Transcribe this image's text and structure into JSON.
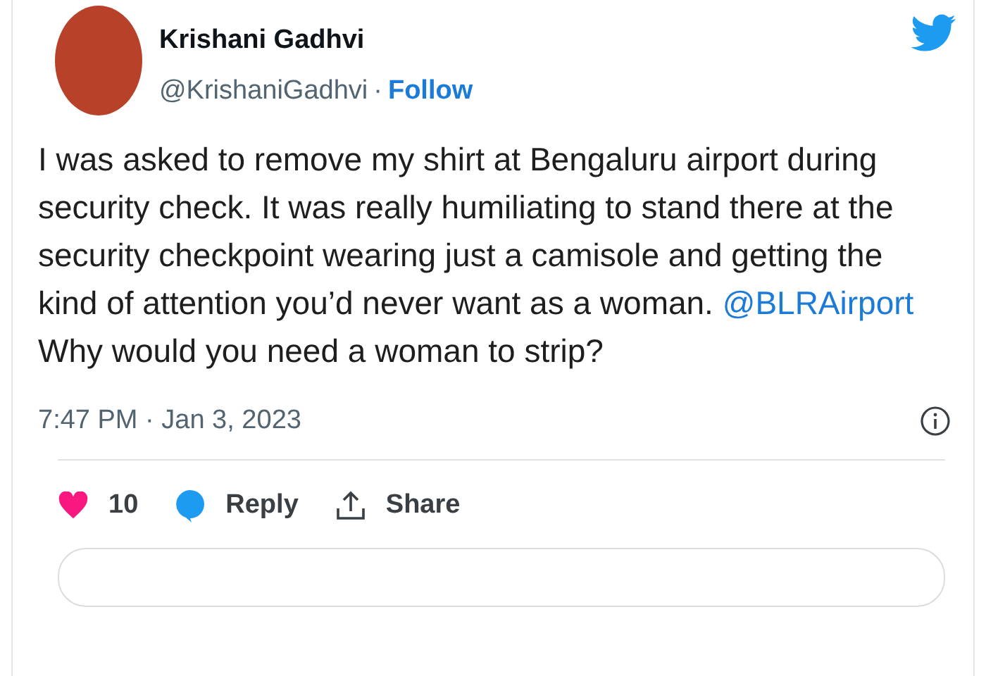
{
  "author": {
    "name": "Krishani Gadhvi",
    "handle": "@KrishaniGadhvi",
    "separator": "·",
    "follow": "Follow"
  },
  "body": [
    {
      "kind": "text",
      "text": "I was asked to remove my shirt at Bengaluru airport during security check. It was really humiliating to stand there at the security checkpoint wearing just a camisole and getting the kind of attention you’d never want as a woman. "
    },
    {
      "kind": "mention",
      "text": "@BLRAirport"
    },
    {
      "kind": "text",
      "text": " Why would you need a woman to strip?"
    }
  ],
  "timestamp": "7:47 PM · Jan 3, 2023",
  "actions": [
    {
      "kind": "like",
      "label": "10"
    },
    {
      "kind": "reply",
      "label": "Reply"
    },
    {
      "kind": "share",
      "label": "Share"
    }
  ]
}
